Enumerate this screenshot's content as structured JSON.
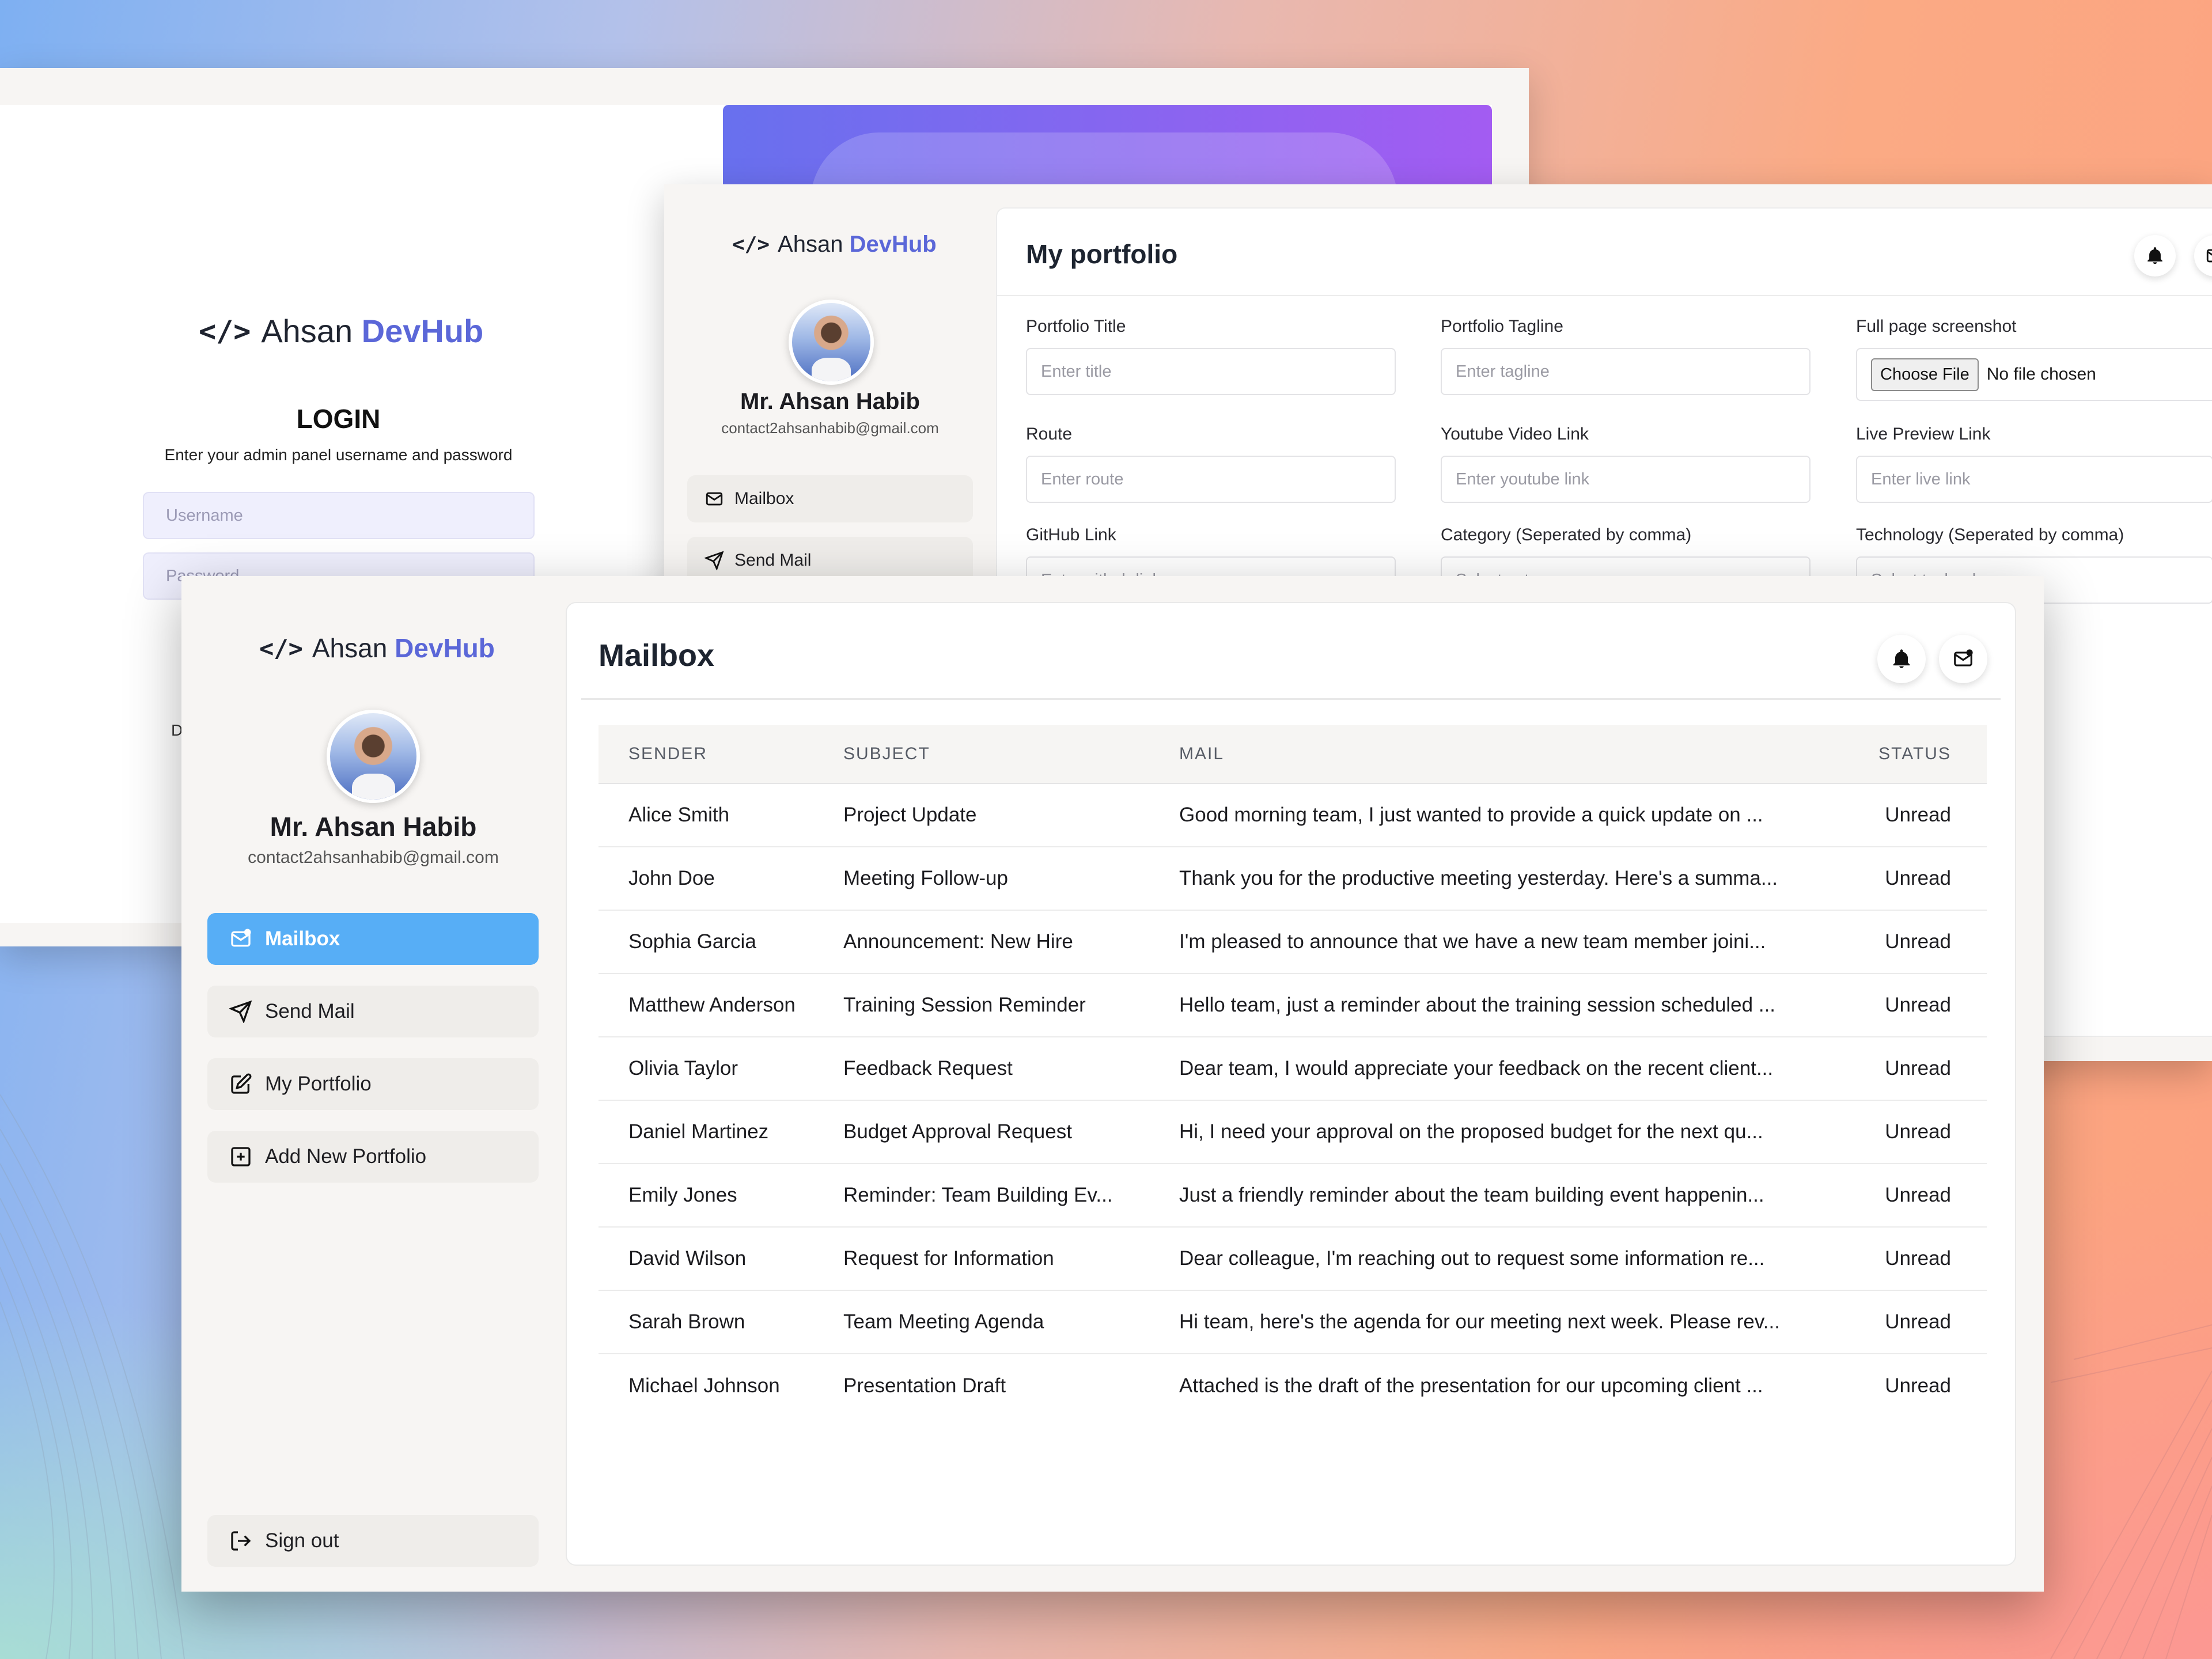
{
  "brand": {
    "code_mark": "</>",
    "name_plain": "Ahsan",
    "name_accent": "DevHub"
  },
  "profile": {
    "name": "Mr. Ahsan Habib",
    "email": "contact2ahsanhabib@gmail.com"
  },
  "login": {
    "title": "LOGIN",
    "subtitle": "Enter your admin panel username and password",
    "username_placeholder": "Username",
    "password_placeholder": "Password",
    "partial_text": "D"
  },
  "portfolio": {
    "title": "My portfolio",
    "nav": [
      {
        "label": "Mailbox",
        "icon": "mailbox-icon"
      },
      {
        "label": "Send Mail",
        "icon": "send-icon"
      }
    ],
    "fields": {
      "portfolio_title": {
        "label": "Portfolio Title",
        "placeholder": "Enter title"
      },
      "portfolio_tagline": {
        "label": "Portfolio Tagline",
        "placeholder": "Enter tagline"
      },
      "screenshot": {
        "label": "Full page screenshot",
        "button": "Choose File",
        "status": "No file chosen"
      },
      "route": {
        "label": "Route",
        "placeholder": "Enter route"
      },
      "youtube": {
        "label": "Youtube Video Link",
        "placeholder": "Enter youtube link"
      },
      "live": {
        "label": "Live Preview Link",
        "placeholder": "Enter live link"
      },
      "github": {
        "label": "GitHub Link",
        "placeholder": "Enter github link"
      },
      "category": {
        "label": "Category (Seperated by comma)",
        "placeholder": "Select category"
      },
      "technology": {
        "label": "Technology (Seperated by comma)",
        "placeholder": "Select technology"
      }
    }
  },
  "mailbox": {
    "title": "Mailbox",
    "nav": [
      {
        "label": "Mailbox",
        "icon": "mailbox-icon",
        "active": true
      },
      {
        "label": "Send Mail",
        "icon": "send-icon"
      },
      {
        "label": "My Portfolio",
        "icon": "edit-icon"
      },
      {
        "label": "Add New Portfolio",
        "icon": "add-square-icon"
      }
    ],
    "signout": "Sign out",
    "columns": [
      "SENDER",
      "SUBJECT",
      "MAIL",
      "STATUS"
    ],
    "rows": [
      {
        "sender": "Alice Smith",
        "subject": "Project Update",
        "mail": "Good morning team, I just wanted to provide a quick update on ...",
        "status": "Unread"
      },
      {
        "sender": "John Doe",
        "subject": "Meeting Follow-up",
        "mail": "Thank you for the productive meeting yesterday. Here's a summa...",
        "status": "Unread"
      },
      {
        "sender": "Sophia Garcia",
        "subject": "Announcement: New Hire",
        "mail": "I'm pleased to announce that we have a new team member joini...",
        "status": "Unread"
      },
      {
        "sender": "Matthew Anderson",
        "subject": "Training Session Reminder",
        "mail": "Hello team, just a reminder about the training session scheduled ...",
        "status": "Unread"
      },
      {
        "sender": "Olivia Taylor",
        "subject": "Feedback Request",
        "mail": "Dear team, I would appreciate your feedback on the recent client...",
        "status": "Unread"
      },
      {
        "sender": "Daniel Martinez",
        "subject": "Budget Approval Request",
        "mail": "Hi, I need your approval on the proposed budget for the next qu...",
        "status": "Unread"
      },
      {
        "sender": "Emily Jones",
        "subject": "Reminder: Team Building Ev...",
        "mail": "Just a friendly reminder about the team building event happenin...",
        "status": "Unread"
      },
      {
        "sender": "David Wilson",
        "subject": "Request for Information",
        "mail": "Dear colleague, I'm reaching out to request some information re...",
        "status": "Unread"
      },
      {
        "sender": "Sarah Brown",
        "subject": "Team Meeting Agenda",
        "mail": "Hi team, here's the agenda for our meeting next week. Please rev...",
        "status": "Unread"
      },
      {
        "sender": "Michael Johnson",
        "subject": "Presentation Draft",
        "mail": "Attached is the draft of the presentation for our upcoming client ...",
        "status": "Unread"
      }
    ]
  },
  "colors": {
    "accent": "#5b67d8",
    "active_nav": "#57aef6",
    "gradient_start": "#6870ee",
    "gradient_end": "#a35cf2"
  }
}
